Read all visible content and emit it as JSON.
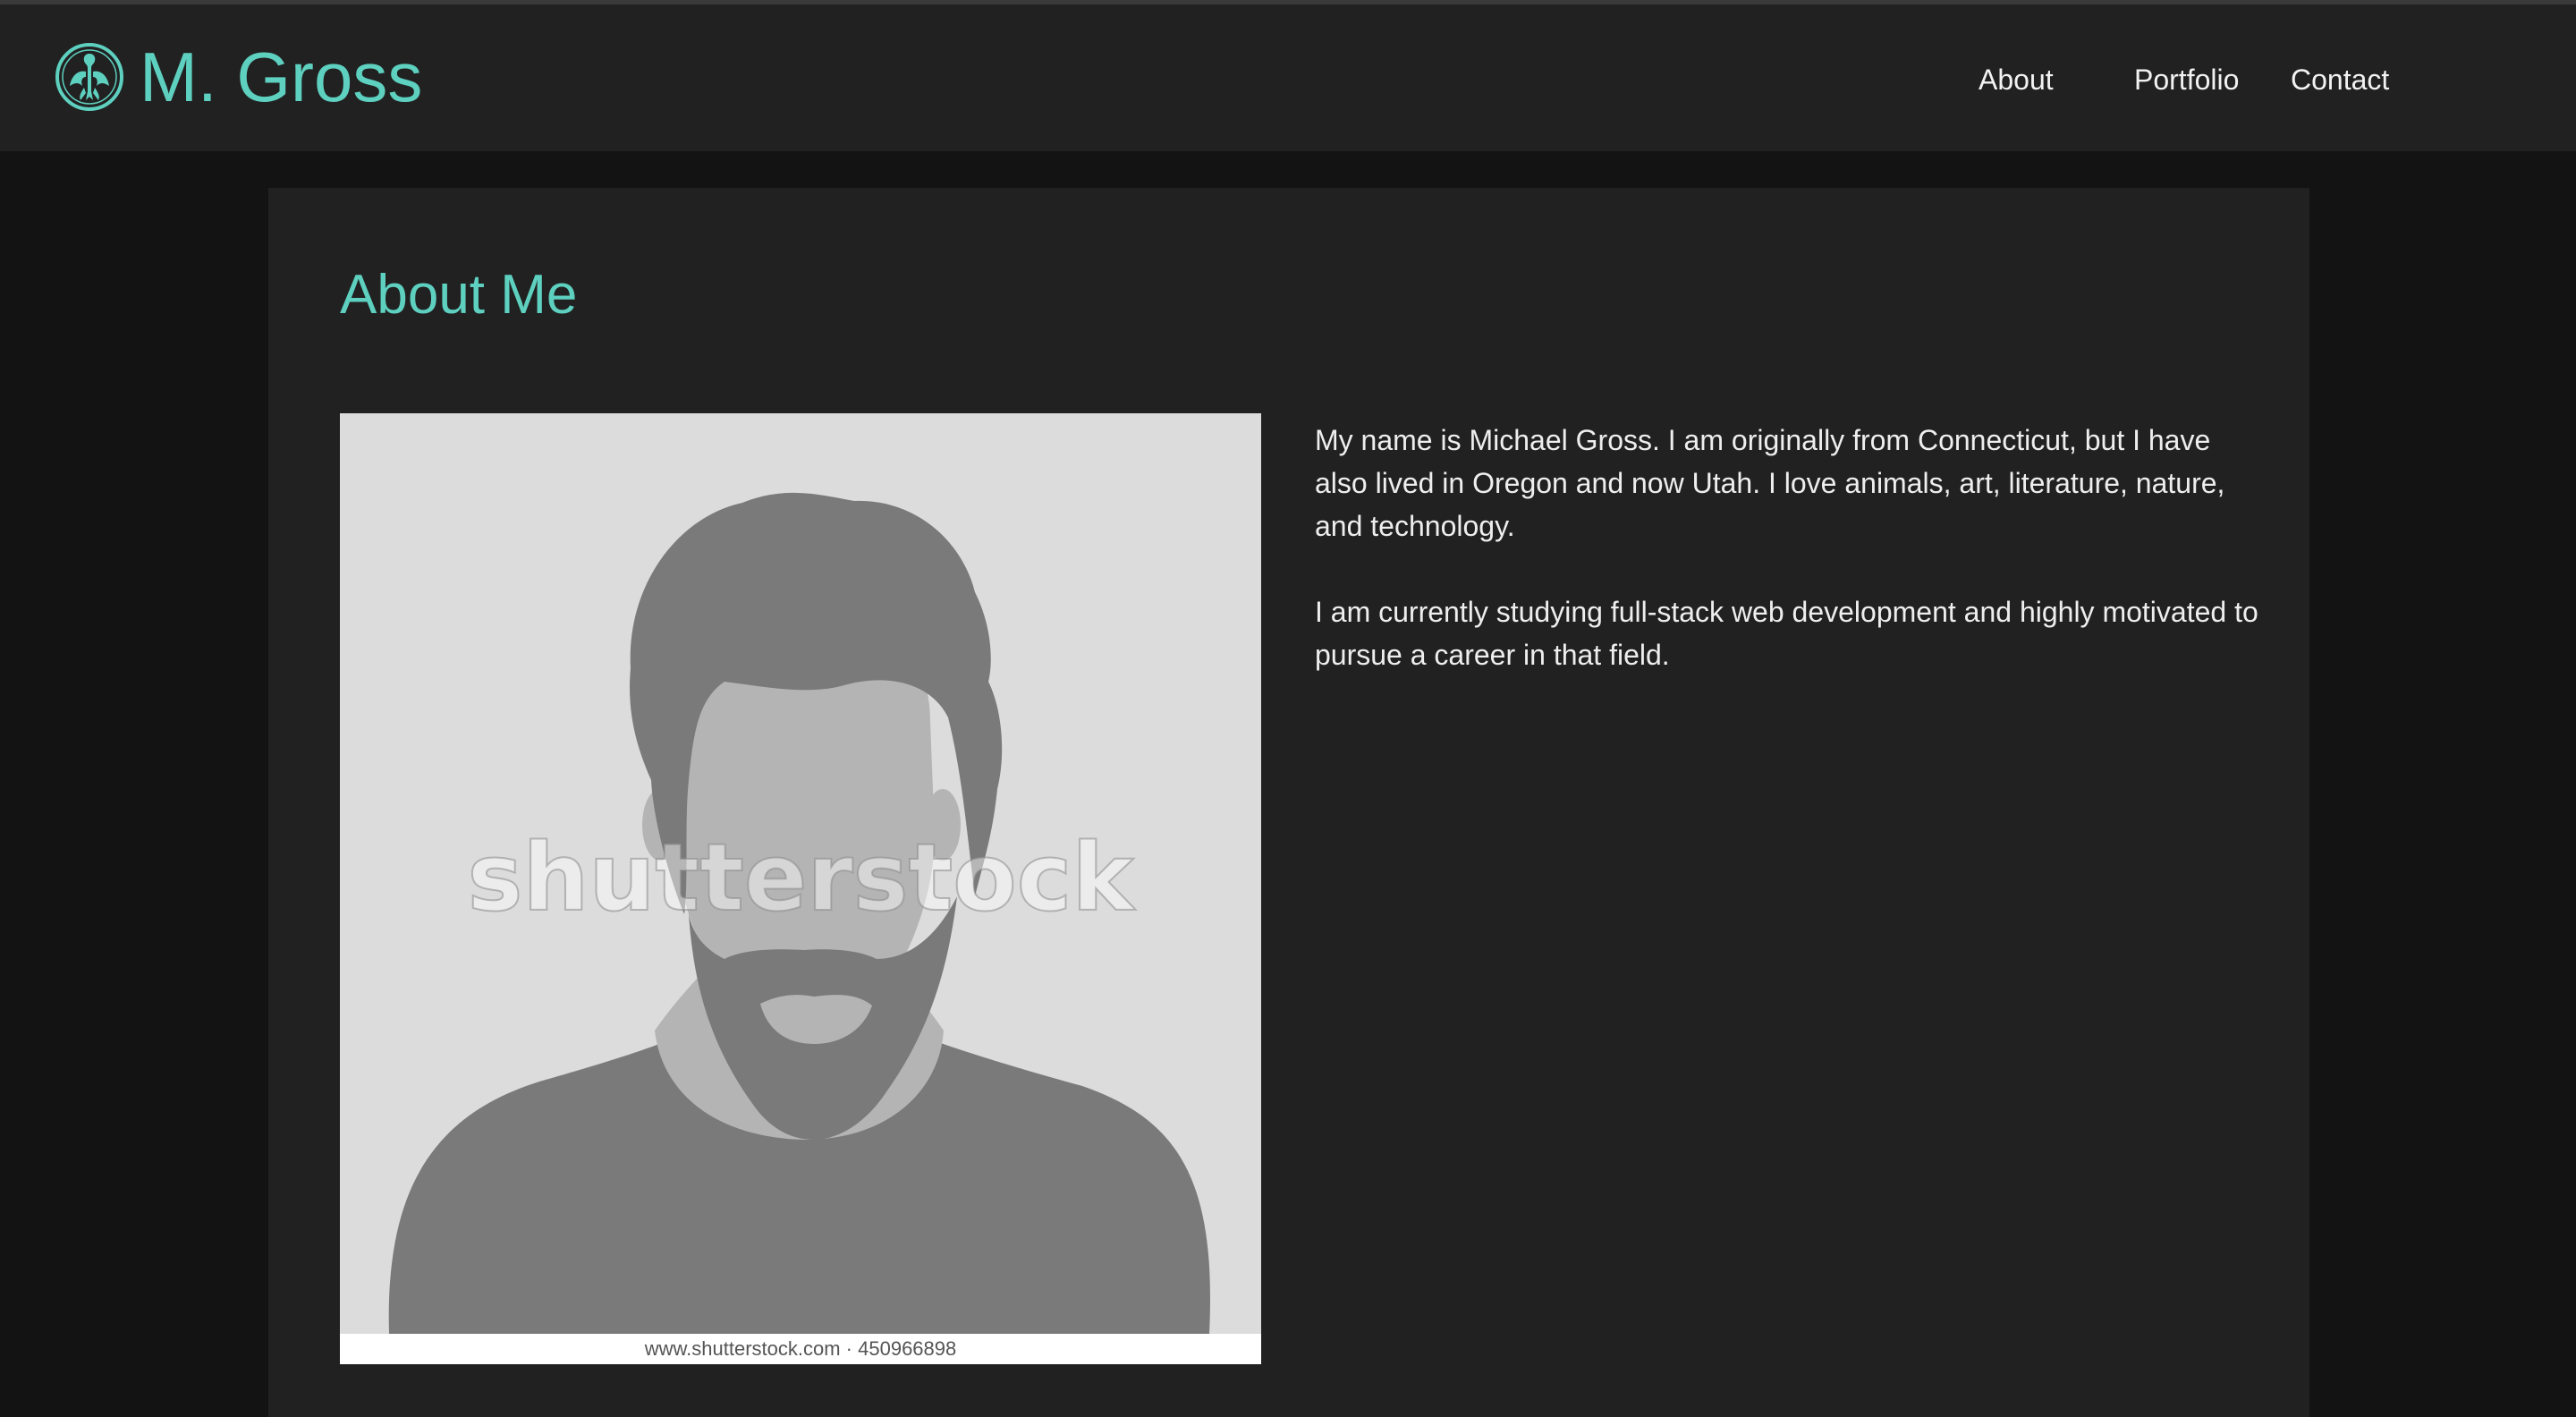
{
  "header": {
    "brand_name": "M. Gross",
    "logo_icon": "phoenix-emblem-icon",
    "nav": [
      {
        "label": "About"
      },
      {
        "label": "Portfolio"
      },
      {
        "label": "Contact"
      }
    ]
  },
  "about": {
    "title": "About Me",
    "photo": {
      "alt": "placeholder profile silhouette",
      "watermark": "shutterstock",
      "caption": "www.shutterstock.com · 450966898"
    },
    "paragraphs": [
      "My name is Michael Gross. I am originally from Connecticut, but I have also lived in Oregon and now Utah. I love animals, art, literature, nature, and technology.",
      "I am currently studying full-stack web development and highly motivated to pursue a career in that field."
    ]
  },
  "colors": {
    "accent": "#5ed0c0",
    "page_background": "#131313",
    "surface": "#212121",
    "text": "#eeeeee"
  }
}
